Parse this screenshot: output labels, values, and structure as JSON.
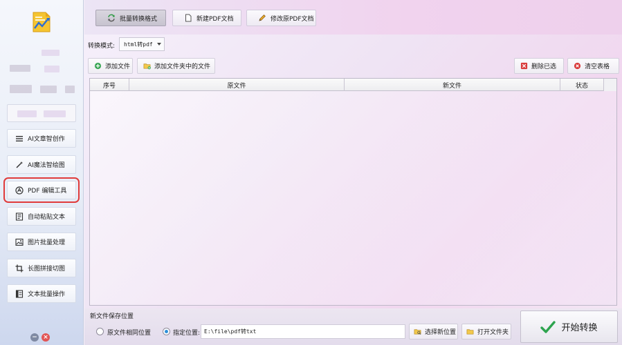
{
  "sidebar": {
    "items": [
      {
        "label": "AI文章智创作",
        "icon": "list-icon"
      },
      {
        "label": "AI魔法智绘图",
        "icon": "magic-wand-icon"
      },
      {
        "label": "PDF 编辑工具",
        "icon": "pdf-logo-icon"
      },
      {
        "label": "自动粘贴文本",
        "icon": "document-icon"
      },
      {
        "label": "图片批量处理",
        "icon": "image-icon"
      },
      {
        "label": "长图拼接切图",
        "icon": "crop-icon"
      },
      {
        "label": "文本批量操作",
        "icon": "text-file-icon"
      }
    ],
    "selected_index": 2
  },
  "tabs": [
    {
      "label": "批量转换格式",
      "icon": "convert-icon",
      "active": true
    },
    {
      "label": "新建PDF文档",
      "icon": "new-doc-icon",
      "active": false
    },
    {
      "label": "修改原PDF文档",
      "icon": "pencil-icon",
      "active": false
    }
  ],
  "mode": {
    "label": "转换模式:",
    "value": "html转pdf"
  },
  "toolbar": {
    "add_file": "添加文件",
    "add_folder": "添加文件夹中的文件",
    "delete_selected": "删除已选",
    "clear_table": "清空表格"
  },
  "table": {
    "columns": [
      "序号",
      "原文件",
      "新文件",
      "状态"
    ],
    "rows": []
  },
  "save": {
    "title": "新文件保存位置",
    "same_location": "原文件相同位置",
    "custom_location": "指定位置:",
    "path": "E:\\file\\pdf转txt",
    "choose_new": "选择新位置",
    "open_folder": "打开文件夹",
    "selected_option": "custom"
  },
  "start": {
    "label": "开始转换"
  },
  "colors": {
    "selected_outline": "#e03a3a",
    "start_check": "#2ea44f",
    "delete_red": "#d93a3a",
    "radio_blue": "#2e8fd9"
  }
}
